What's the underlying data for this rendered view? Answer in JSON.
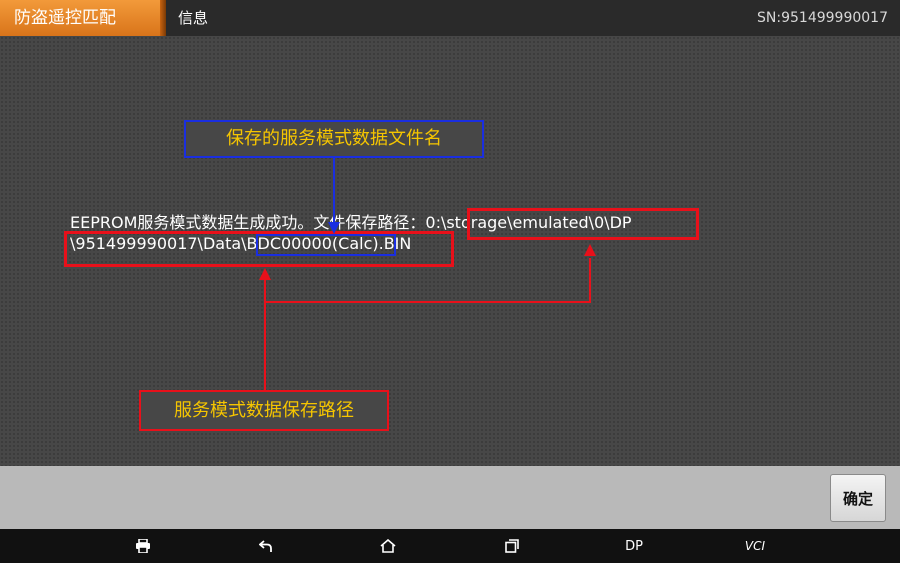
{
  "header": {
    "active_tab": "防盗遥控匹配",
    "info_tab": "信息",
    "serial": "SN:951499990017"
  },
  "message": {
    "line1": "EEPROM服务模式数据生成成功。文件保存路径：0:\\storage\\emulated\\0\\DP",
    "line2": "\\951499990017\\Data\\BDC00000(Calc).BIN"
  },
  "annotations": {
    "file_name_label": "保存的服务模式数据文件名",
    "path_label": "服务模式数据保存路径"
  },
  "footer": {
    "ok_label": "确定"
  },
  "navbar": {
    "dp_label": "DP",
    "vci_label": "VCI"
  },
  "colors": {
    "accent": "#e8841f",
    "highlight_red": "#e8101a",
    "highlight_blue": "#1a2ee0",
    "callout_text": "#f5c500"
  }
}
